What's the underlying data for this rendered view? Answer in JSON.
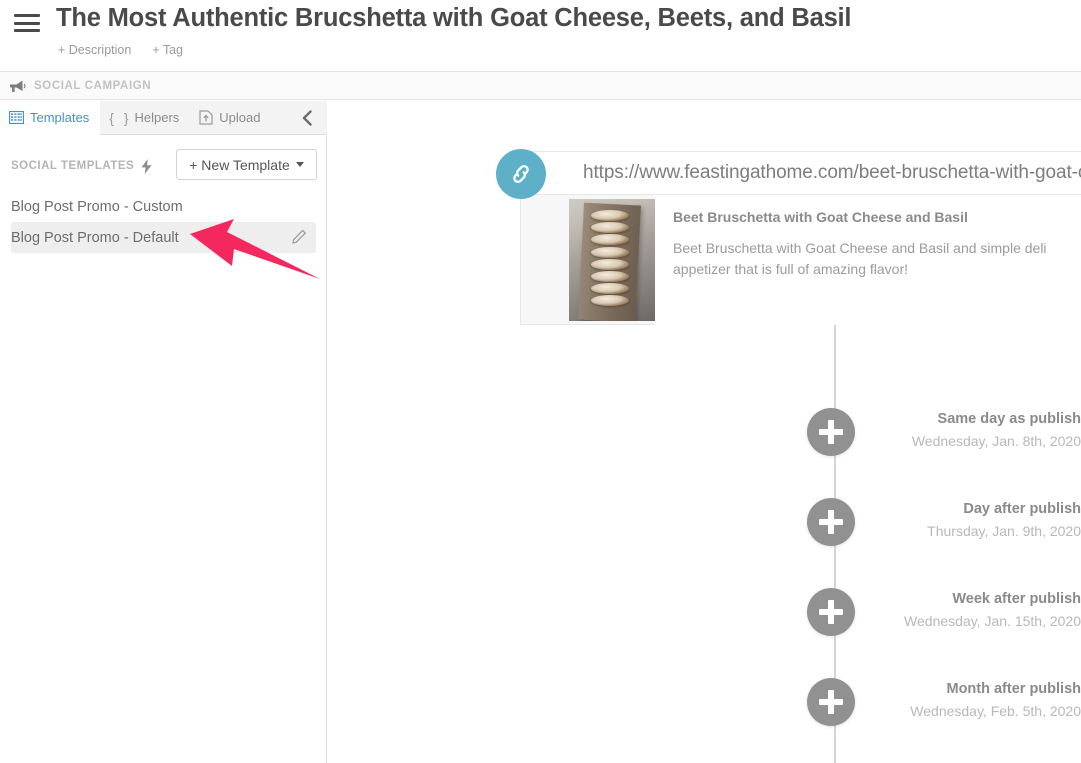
{
  "header": {
    "menu_icon": "hamburger-icon",
    "title": "The Most Authentic Brucshetta with Goat Cheese, Beets, and Basil",
    "add_description": "+ Description",
    "add_tag": "+ Tag"
  },
  "campaign_bar": {
    "icon": "megaphone-icon",
    "label": "SOCIAL CAMPAIGN"
  },
  "left_panel": {
    "tabs": [
      {
        "label": "Templates",
        "icon": "grid-template-icon",
        "active": true
      },
      {
        "label": "Helpers",
        "icon": "curly-braces-icon",
        "active": false
      },
      {
        "label": "Upload",
        "icon": "upload-document-icon",
        "active": false
      }
    ],
    "collapse_icon": "chevron-left-icon",
    "section_title": "SOCIAL TEMPLATES",
    "section_icon": "lightning-bolt-icon",
    "new_template_button": "+ New Template",
    "templates": [
      {
        "name": "Blog Post Promo - Custom",
        "selected": false
      },
      {
        "name": "Blog Post Promo - Default",
        "selected": true
      }
    ],
    "edit_icon": "pencil-icon"
  },
  "main": {
    "link_icon": "chain-link-icon",
    "url": "https://www.feastingathome.com/beet-bruschetta-with-goat-che",
    "preview": {
      "image_alt": "beet-bruschetta-photo",
      "title": "Beet Bruschetta with Goat Cheese and Basil",
      "description": "Beet Bruschetta with Goat Cheese and Basil and simple deli appetizer that is full of amazing flavor!"
    },
    "timeline": [
      {
        "title": "Same day as publish",
        "date": "Wednesday, Jan. 8th, 2020",
        "add_icon": "plus-icon"
      },
      {
        "title": "Day after publish",
        "date": "Thursday, Jan. 9th, 2020",
        "add_icon": "plus-icon"
      },
      {
        "title": "Week after publish",
        "date": "Wednesday, Jan. 15th, 2020",
        "add_icon": "plus-icon"
      },
      {
        "title": "Month after publish",
        "date": "Wednesday, Feb. 5th, 2020",
        "add_icon": "plus-icon"
      }
    ]
  },
  "annotation": {
    "arrow_icon": "red-pointer-arrow",
    "color": "#f5275f"
  },
  "colors": {
    "accent_blue": "#4a90c4",
    "link_circle": "#5eb0c9",
    "node_gray": "#919191",
    "text_dark": "#4a4a4a",
    "text_muted": "#9b9b9b"
  }
}
